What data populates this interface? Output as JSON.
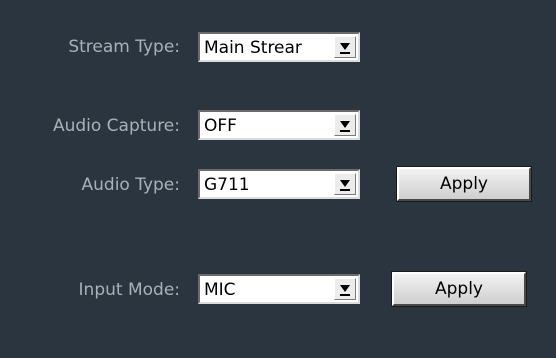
{
  "form": {
    "stream_type": {
      "label": "Stream Type:",
      "value": "Main Strear"
    },
    "audio_capture": {
      "label": "Audio Capture:",
      "value": "OFF"
    },
    "audio_type": {
      "label": "Audio Type:",
      "value": "G711",
      "apply_label": "Apply"
    },
    "input_mode": {
      "label": "Input Mode:",
      "value": "MIC",
      "apply_label": "Apply"
    }
  },
  "colors": {
    "background": "#2b3540",
    "label_text": "#a9b1b8"
  },
  "icons": {
    "dropdown": "dropdown-arrow-icon"
  }
}
